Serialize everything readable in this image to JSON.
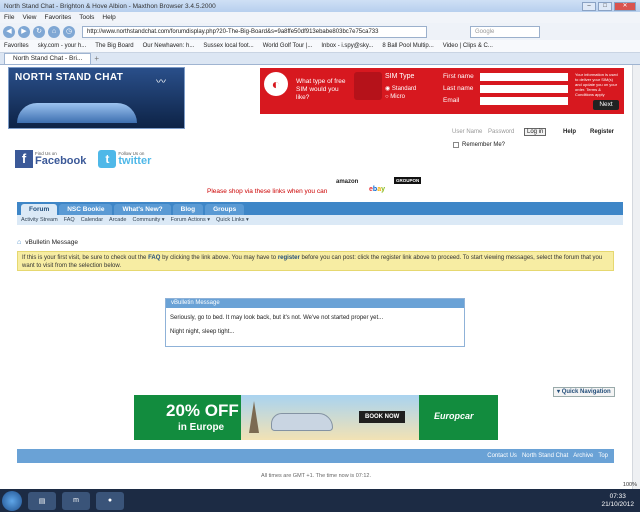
{
  "window": {
    "title": "North Stand Chat - Brighton & Hove Albion - Maxthon Browser 3.4.5.2000"
  },
  "menu": [
    "File",
    "View",
    "Favorites",
    "Tools",
    "Help"
  ],
  "browser": {
    "url": "http://www.northstandchat.com/forumdisplay.php?20-The-Big-Board&s=9a8ffe50df913ebabe803bc7e75ca733",
    "search_placeholder": "Google",
    "favorites": [
      "Favorites",
      "sky.com - your h...",
      "The Big Board",
      "Our Newhaven: h...",
      "Sussex local foot...",
      "World Golf Tour |...",
      "Inbox - i.spy@sky...",
      "8 Ball Pool Multip...",
      "Video | Clips & C..."
    ],
    "tab_label": "North Stand Chat - Bri..."
  },
  "site": {
    "logo_text": "NORTH STAND CHAT",
    "login": {
      "username_placeholder": "User Name",
      "password_placeholder": "Password",
      "login_button": "Log in",
      "help": "Help",
      "register": "Register",
      "remember_me": "Remember Me?"
    },
    "social": {
      "facebook_small": "Find Us on",
      "facebook_big": "Facebook",
      "twitter_small": "Follow Us on",
      "twitter_big": "twitter"
    },
    "shop_links_text": "Please shop via these links when you can",
    "amazon": "amazon",
    "groupon": "GROUPON",
    "nav": [
      "Forum",
      "NSC Bookie",
      "What's New?",
      "Blog",
      "Groups"
    ],
    "subnav": [
      "Activity Stream",
      "FAQ",
      "Calendar",
      "Arcade",
      "Community ▾",
      "Forum Actions ▾",
      "Quick Links ▾"
    ],
    "breadcrumb": "vBulletin Message",
    "notice_pre": "If this is your first visit, be sure to check out the ",
    "notice_faq": "FAQ",
    "notice_mid": " by clicking the link above. You may have to ",
    "notice_register": "register",
    "notice_post": " before you can post: click the register link above to proceed. To start viewing messages, select the forum that you want to visit from the selection below.",
    "message": {
      "header": "vBulletin Message",
      "line1": "Seriously, go to bed. It may look back, but it's not. We've not started proper yet...",
      "line2": "Night night, sleep tight..."
    },
    "quick_nav": "Quick Navigation",
    "footer_links": [
      "Contact Us",
      "North Stand Chat",
      "Archive",
      "Top"
    ],
    "footer_note": "All times are GMT +1. The time now is 07:12."
  },
  "ads": {
    "vodafone": {
      "question": "What type of free SIM would you like?",
      "sim_type": "SIM Type",
      "standard": "Standard",
      "micro": "Micro",
      "first_name": "First name",
      "last_name": "Last name",
      "email": "Email",
      "fine_print": "Your information is used to deliver your SIM(s) and update you on your order. Terms & Conditions apply",
      "next": "Next"
    },
    "europcar": {
      "headline": "20% OFF",
      "sub": "in Europe",
      "book": "BOOK NOW",
      "brand": "Europcar"
    }
  },
  "taskbar": {
    "time": "07:33",
    "date": "21/10/2012",
    "zoom": "100%"
  }
}
